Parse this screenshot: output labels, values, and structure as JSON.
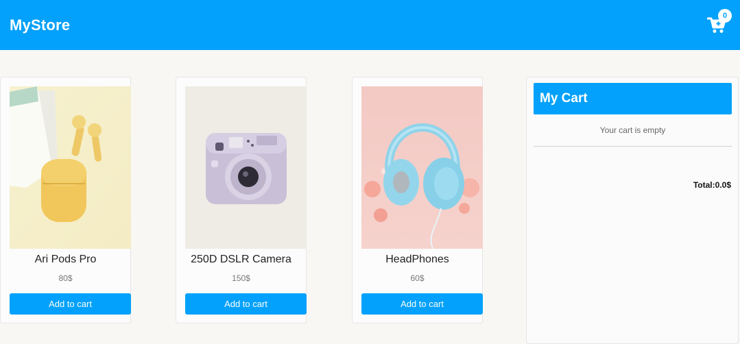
{
  "navbar": {
    "brand": "MyStore",
    "cart_count": "0",
    "color": "#03a1fb"
  },
  "products": [
    {
      "name": "Ari Pods Pro",
      "price": "80$",
      "button": "Add to cart",
      "image": "airpods"
    },
    {
      "name": "250D DSLR Camera",
      "price": "150$",
      "button": "Add to cart",
      "image": "instant-camera"
    },
    {
      "name": "HeadPhones",
      "price": "60$",
      "button": "Add to cart",
      "image": "headphones"
    }
  ],
  "cart": {
    "title": "My Cart",
    "empty_message": "Your cart is empty",
    "total_label": "Total:",
    "total_value": "0.0$"
  }
}
